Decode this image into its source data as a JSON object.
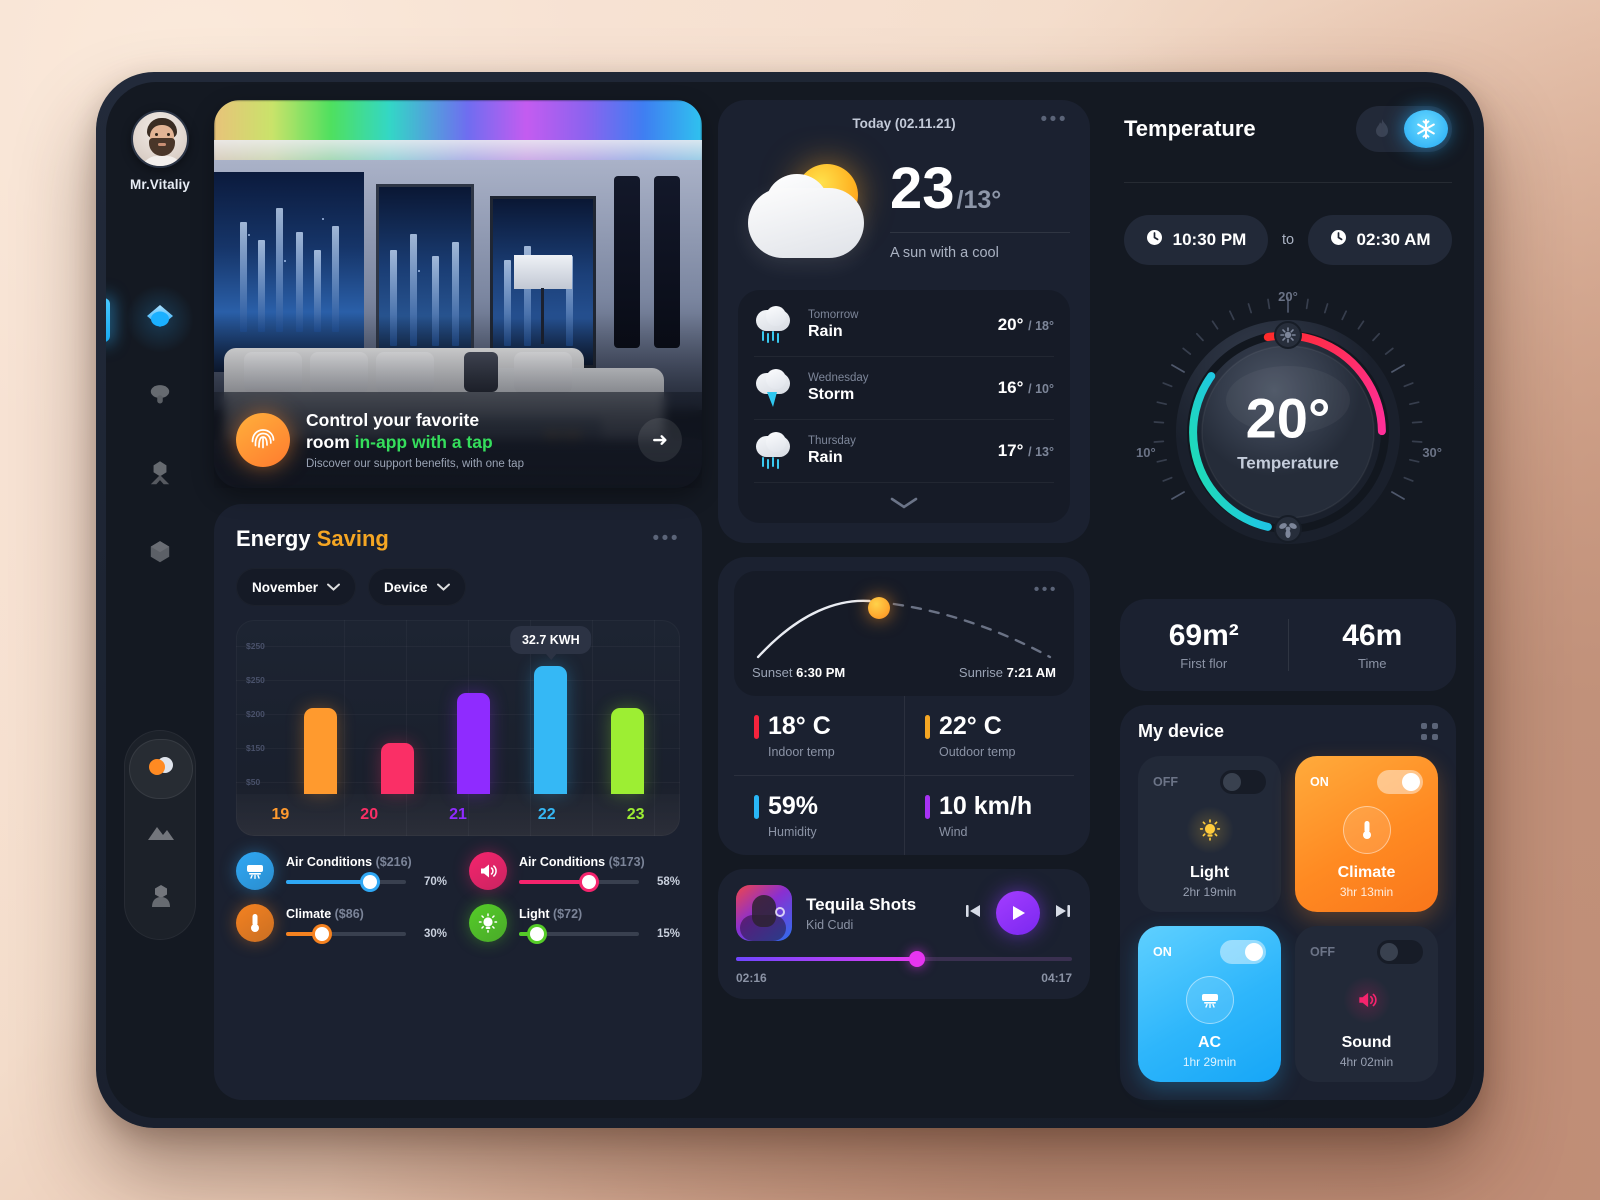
{
  "user": {
    "name": "Mr.Vitaliy",
    "avatar_icon": "user-avatar"
  },
  "sidebar": {
    "primary": [
      {
        "name": "home-icon",
        "label": "Home",
        "active": true
      },
      {
        "name": "lamp-icon",
        "label": "Lighting",
        "active": false
      },
      {
        "name": "security-icon",
        "label": "Security",
        "active": false
      },
      {
        "name": "devices-icon",
        "label": "Devices",
        "active": false
      }
    ],
    "secondary": [
      {
        "name": "climate-icon",
        "label": "Climate",
        "selected": true
      },
      {
        "name": "gallery-icon",
        "label": "Gallery",
        "selected": false
      },
      {
        "name": "profile-icon",
        "label": "Profile",
        "selected": false
      }
    ]
  },
  "hero": {
    "promo_title_a": "Control your favorite",
    "promo_title_b": "room ",
    "promo_title_highlight": "in-app with a tap",
    "promo_sub": "Discover our support benefits, with one tap",
    "fingerprint_icon": "fingerprint-icon",
    "arrow_icon": "arrow-right-icon"
  },
  "energy": {
    "title_a": "Energy ",
    "title_b": "Saving",
    "menu_icon": "more-options-icon",
    "month_filter": "November",
    "device_filter": "Device",
    "tooltip": "32.7 KWH",
    "devices": [
      {
        "icon": "air-conditioner-icon",
        "name": "Air Conditions",
        "cost": "($216)",
        "percent": "70%",
        "value": 70,
        "color": "#2fa8f5"
      },
      {
        "icon": "speaker-icon",
        "name": "Air Conditions",
        "cost": "($173)",
        "percent": "58%",
        "value": 58,
        "color": "#f5246d"
      },
      {
        "icon": "thermometer-icon",
        "name": "Climate",
        "cost": "($86)",
        "percent": "30%",
        "value": 30,
        "color": "#f58220"
      },
      {
        "icon": "bulb-icon",
        "name": "Light",
        "cost": "($72)",
        "percent": "15%",
        "value": 15,
        "color": "#55cc28"
      }
    ]
  },
  "chart_data": {
    "type": "bar",
    "title": "Energy Saving",
    "categories": [
      "19",
      "20",
      "21",
      "22",
      "23"
    ],
    "values": [
      160,
      95,
      188,
      238,
      160
    ],
    "bar_colors": [
      "#ff9a2e",
      "#fa2f66",
      "#8f2bff",
      "#35b8f5",
      "#9dee33"
    ],
    "ylabel": "",
    "xlabel": "",
    "ytick_labels": [
      "$250",
      "$250",
      "$200",
      "$150",
      "$50"
    ],
    "ytick_values": [
      250,
      250,
      200,
      150,
      50
    ],
    "ylim": [
      0,
      290
    ],
    "grid": true,
    "annotation": {
      "category": "22",
      "text": "32.7 KWH"
    },
    "legend": "none"
  },
  "weather": {
    "today_label": "Today (02.11.21)",
    "menu_icon": "more-options-icon",
    "icon": "sun-behind-cloud-icon",
    "temp_high": "23",
    "temp_low": "/13°",
    "description": "A sun with a cool",
    "forecast": [
      {
        "icon": "rain-icon",
        "day": "Tomorrow",
        "condition": "Rain",
        "high": "20°",
        "low": "/ 18°"
      },
      {
        "icon": "storm-icon",
        "day": "Wednesday",
        "condition": "Storm",
        "high": "16°",
        "low": "/ 10°"
      },
      {
        "icon": "rain-icon",
        "day": "Thursday",
        "condition": "Rain",
        "high": "17°",
        "low": "/ 13°"
      }
    ],
    "expand_icon": "chevron-down-icon"
  },
  "sun": {
    "menu_icon": "more-options-icon",
    "sunset_label": "Sunset ",
    "sunset_time": "6:30 PM",
    "sunrise_label": "Sunrise ",
    "sunrise_time": "7:21 AM"
  },
  "stats": [
    {
      "value": "18° C",
      "label": "Indoor temp",
      "color": "#f5233c"
    },
    {
      "value": "22° C",
      "label": "Outdoor temp",
      "color": "#f5a623"
    },
    {
      "value": "59%",
      "label": "Humidity",
      "color": "#29b6f6"
    },
    {
      "value": "10 km/h",
      "label": "Wind",
      "color": "#a832f5"
    }
  ],
  "music": {
    "title": "Tequila Shots",
    "artist": "Kid Cudi",
    "elapsed": "02:16",
    "duration": "04:17",
    "prev_icon": "previous-track-icon",
    "play_icon": "play-icon",
    "next_icon": "next-track-icon",
    "cover_icon": "album-art"
  },
  "temperature": {
    "title": "Temperature",
    "heat_icon": "flame-icon",
    "cool_icon": "snowflake-icon",
    "mode": "cool",
    "from_time": "10:30 PM",
    "to_label": "to",
    "until_time": "02:30 AM",
    "clock_icon": "clock-icon",
    "dial_value": "20°",
    "dial_label": "Temperature",
    "dial_min": "10°",
    "dial_mid": "20°",
    "dial_max": "30°",
    "handle_top_icon": "brightness-icon",
    "handle_bottom_icon": "fan-icon"
  },
  "area": [
    {
      "value": "69m²",
      "label": "First flor"
    },
    {
      "value": "46m",
      "label": "Time"
    }
  ],
  "my_device": {
    "title": "My device",
    "grip_icon": "drag-handle-icon",
    "tiles": [
      {
        "state": "OFF",
        "on": false,
        "icon": "bulb-icon",
        "name": "Light",
        "time": "2hr 19min",
        "style": "off"
      },
      {
        "state": "ON",
        "on": true,
        "icon": "thermometer-icon",
        "name": "Climate",
        "time": "3hr 13min",
        "style": "warm"
      },
      {
        "state": "ON",
        "on": true,
        "icon": "air-conditioner-icon",
        "name": "AC",
        "time": "1hr 29min",
        "style": "cool"
      },
      {
        "state": "OFF",
        "on": false,
        "icon": "speaker-icon",
        "name": "Sound",
        "time": "4hr 02min",
        "style": "off"
      }
    ]
  },
  "colors": {
    "accent_blue": "#2fa8f5",
    "accent_orange": "#f5a623",
    "accent_green": "#35de5c",
    "accent_purple": "#8c3cff",
    "panel": "#1b2130",
    "screen": "#141922"
  }
}
